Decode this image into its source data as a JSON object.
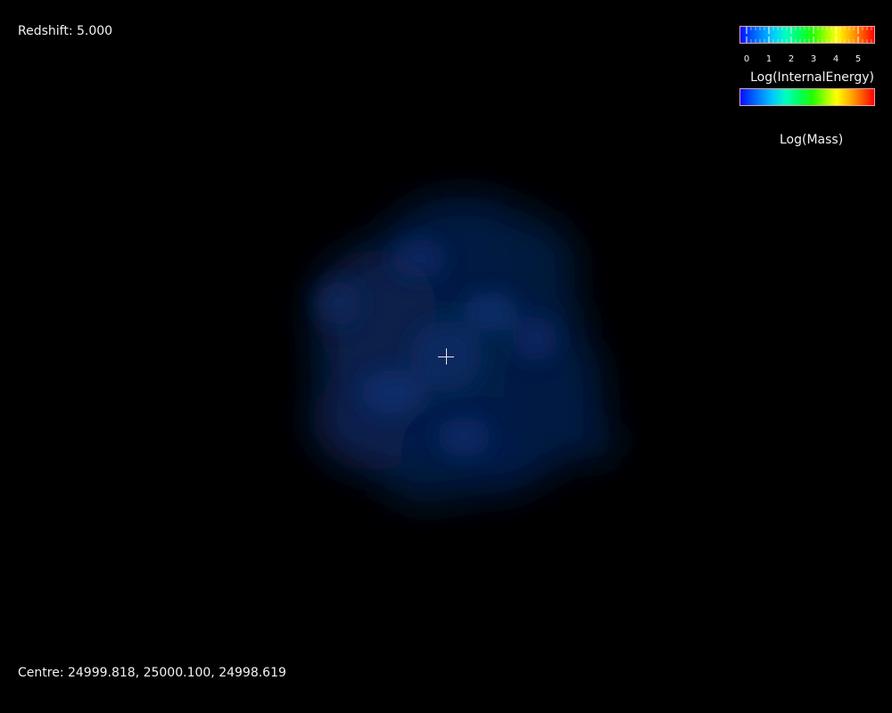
{
  "viewer": {
    "redshift_text": "Redshift: 5.000",
    "centre_text": "Centre: 24999.818, 25000.100, 24998.619"
  },
  "colorbars": {
    "energy": {
      "label": "Log(InternalEnergy)",
      "ticks": [
        "0",
        "1",
        "2",
        "3",
        "4",
        "5"
      ]
    },
    "mass": {
      "label": "Log(Mass)"
    }
  },
  "colors": {
    "background": "#000000",
    "gas_blue": "#0a2a6a",
    "crosshair": "#e8e8e8",
    "colorbar_border": "#e8a0a0"
  }
}
